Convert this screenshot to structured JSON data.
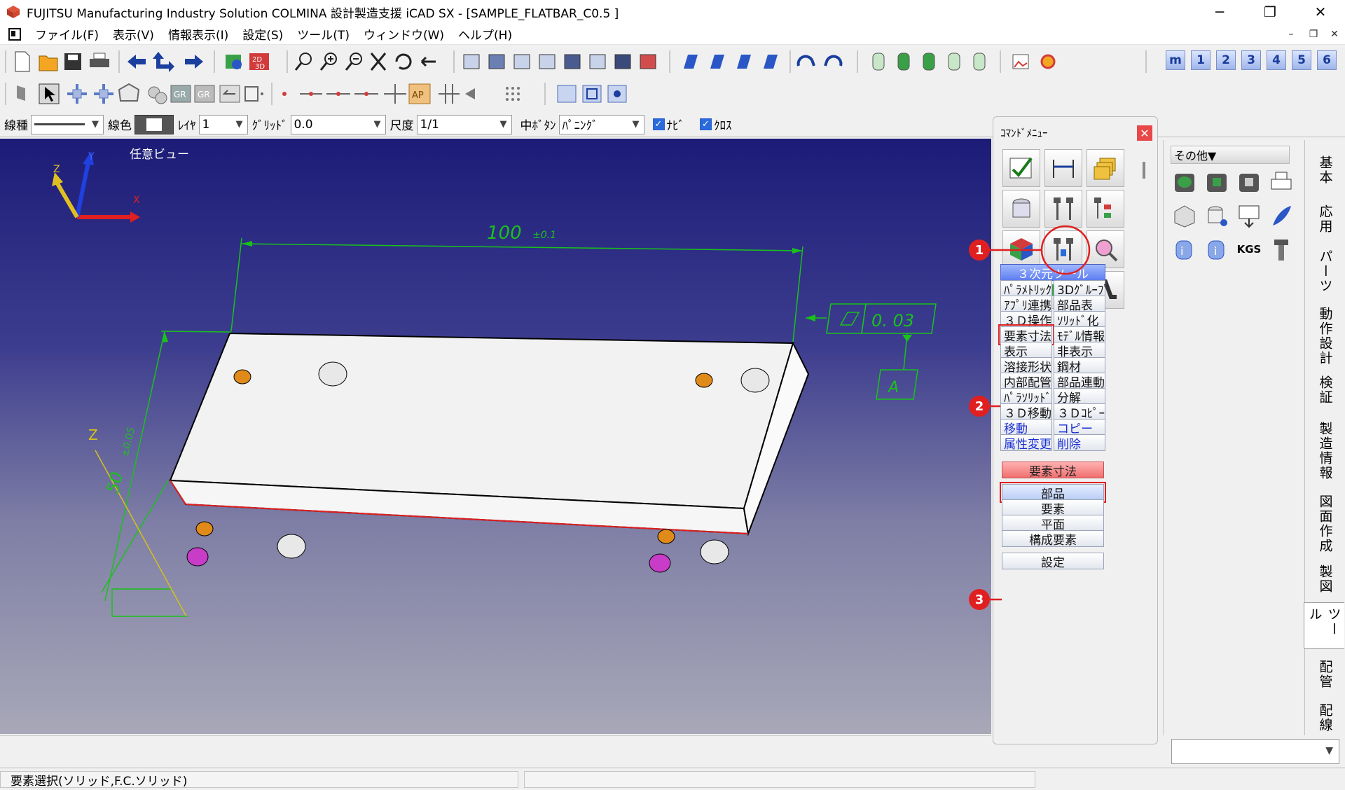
{
  "window": {
    "title": "FUJITSU Manufacturing Industry Solution COLMINA 設計製造支援 iCAD SX - [SAMPLE_FLATBAR_C0.5 ]",
    "minimize": "─",
    "maximize": "❐",
    "close": "✕"
  },
  "menu": {
    "items": [
      "ファイル(F)",
      "表示(V)",
      "情報表示(I)",
      "設定(S)",
      "ツール(T)",
      "ウィンドウ(W)",
      "ヘルプ(H)"
    ],
    "mdi_min": "–",
    "mdi_restore": "❐",
    "mdi_close": "✕"
  },
  "toolbar": {
    "number_buttons": [
      "m",
      "1",
      "2",
      "3",
      "4",
      "5",
      "6"
    ],
    "icons_row1": [
      "new-file-icon",
      "open-folder-icon",
      "save-icon",
      "print-icon",
      "arrow-left-icon",
      "arrow-updown-icon",
      "arrow-right-icon",
      "render-icon",
      "2d3d-icon",
      "zoom-icon",
      "zoom-in-icon",
      "zoom-out-icon",
      "fit-icon",
      "rotate-icon",
      "pan-icon",
      "view-cube-icons",
      "undo-icon",
      "redo-icon",
      "layer-cylinder-icons",
      "image-icon",
      "ring-icon"
    ],
    "icons_row2": [
      "select-icon",
      "pointer-icon",
      "move-icon",
      "polygon-icon",
      "snap-icon",
      "gr-icon",
      "point-icon",
      "line-icon",
      "ap-icon",
      "grid-icon",
      "view-mode-icons"
    ]
  },
  "properties": {
    "line_type_label": "線種",
    "line_color_label": "線色",
    "layer_label": "ﾚｲﾔ",
    "layer_value": "1",
    "grid_label": "ｸﾞﾘｯﾄﾞ",
    "grid_value": "0.0",
    "scale_label": "尺度",
    "scale_value": "1/1",
    "middle_button_label": "中ﾎﾞﾀﾝ",
    "middle_button_value": "ﾊﾟﾆﾝｸﾞ",
    "check1_label": "ﾅﾋﾞ",
    "check2_label": "ｸﾛｽ"
  },
  "viewport": {
    "view_label": "任意ビュー",
    "axis_x": "X",
    "axis_y": "Y",
    "axis_z": "Z",
    "dim_length": "100",
    "dim_length_tol": "±0.1",
    "dim_height": "50",
    "dim_height_tol": "±0.05",
    "dim_z": "Z",
    "flatness_value": "0. 03",
    "datum": "A",
    "colors": {
      "edge": "#000000",
      "face": "#f2f2f2",
      "dimension": "#19c219",
      "hole_gray": "#e8e8e8",
      "hole_orange": "#e08a1a",
      "hole_magenta": "#c83cc8"
    }
  },
  "command_menu": {
    "title": "ｺﾏﾝﾄﾞﾒﾆｭｰ",
    "close": "✕",
    "icons": [
      "check-icon",
      "dimension-icon",
      "stack-icon",
      "hole-icon",
      "tools-icon",
      "tree-icon",
      "cube-icon",
      "part-tools-icon",
      "analyze-icon",
      "list-icon",
      "solid-icon",
      "bend-icon"
    ],
    "section_header": "３次元ツール",
    "buttons": [
      [
        "ﾊﾟﾗﾒﾄﾘｯｸ",
        "3Dｸﾞﾙｰﾌﾟ"
      ],
      [
        "ｱﾌﾟﾘ連携",
        "部品表"
      ],
      [
        "３Ｄ操作",
        "ｿﾘｯﾄﾞ化"
      ],
      [
        "要素寸法",
        "ﾓﾃﾞﾙ情報"
      ],
      [
        "表示",
        "非表示"
      ],
      [
        "溶接形状",
        "鋼材"
      ],
      [
        "内部配管",
        "部品連動"
      ],
      [
        "ﾊﾟﾗｿﾘｯﾄﾞ",
        "分解"
      ],
      [
        "３Ｄ移動",
        "３Ｄｺﾋﾟｰ"
      ],
      [
        "移動",
        "コピー"
      ],
      [
        "属性変更",
        "削除"
      ]
    ],
    "sub_header": "要素寸法",
    "sub_buttons": [
      "部品",
      "要素",
      "平面",
      "構成要素"
    ],
    "settings_button": "設定"
  },
  "callouts": [
    "1",
    "2",
    "3"
  ],
  "right_palette": {
    "header": "その他▼",
    "kgs_label": "KGS"
  },
  "vertical_tabs": [
    "基本",
    "応用",
    "パーツ",
    "動作設計",
    "検証",
    "製造情報",
    "図面作成",
    "製図",
    "ツール",
    "配管",
    "配線"
  ],
  "status": {
    "message": "要素選択(ソリッド,F.C.ソリッド)"
  }
}
